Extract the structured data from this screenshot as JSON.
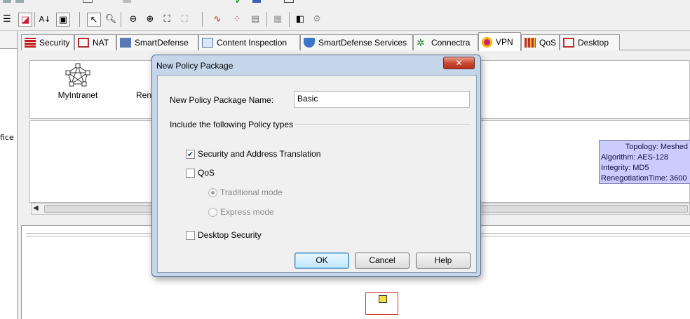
{
  "tabs": [
    {
      "label": "Security",
      "icon": "firewall-icon",
      "color": "#c02020"
    },
    {
      "label": "NAT",
      "icon": "nat-table-icon",
      "color": "#b03030"
    },
    {
      "label": "SmartDefense",
      "icon": "smartdefense-icon",
      "color": "#3a5fa8"
    },
    {
      "label": "Content Inspection",
      "icon": "content-inspection-icon",
      "color": "#5a7ab0"
    },
    {
      "label": "SmartDefense Services",
      "icon": "shield-icon",
      "color": "#3c78c8"
    },
    {
      "label": "Connectra",
      "icon": "connectra-icon",
      "color": "#2e8a2e"
    },
    {
      "label": "VPN",
      "icon": "vpn-lock-icon",
      "color": "#d0207a"
    },
    {
      "label": "QoS",
      "icon": "qos-icon",
      "color": "#c03030"
    },
    {
      "label": "Desktop",
      "icon": "desktop-icon",
      "color": "#c03030"
    }
  ],
  "active_tab": "VPN",
  "left_pane": {
    "truncated_label": "fice"
  },
  "community": {
    "label": "MyIntranet",
    "icon": "star-community-icon"
  },
  "partial_label": "Ren",
  "tooltip": {
    "topology": "Topology: Meshed",
    "algorithm": "Algorithm: AES-128",
    "integrity": "Integrity: MD5",
    "renegotiation": "RenegotiationTime: 3600"
  },
  "dialog": {
    "title": "New Policy Package",
    "close_glyph": "✕",
    "name_label": "New Policy Package Name:",
    "name_value": "Basic",
    "group_label": "Include the following Policy types",
    "options": {
      "security": {
        "label": "Security and Address Translation",
        "checked": true
      },
      "qos": {
        "label": "QoS",
        "checked": false
      },
      "traditional": {
        "label": "Traditional mode",
        "selected": true,
        "enabled": false
      },
      "express": {
        "label": "Express mode",
        "selected": false,
        "enabled": false
      },
      "desktop": {
        "label": "Desktop Security",
        "checked": false
      }
    },
    "buttons": {
      "ok": "OK",
      "cancel": "Cancel",
      "help": "Help"
    }
  },
  "toolbar": {
    "icons": [
      "menu-icon",
      "layout-icon",
      "sort-icon",
      "save-icon",
      "select-pointer-icon",
      "zoom-tool-icon",
      "zoom-out-icon",
      "zoom-in-icon",
      "fit-window-icon",
      "fit-selection-icon",
      "connect-icon",
      "meshed-icon",
      "properties-icon",
      "calculator-icon",
      "panel-icon",
      "vpn-settings-icon"
    ]
  }
}
